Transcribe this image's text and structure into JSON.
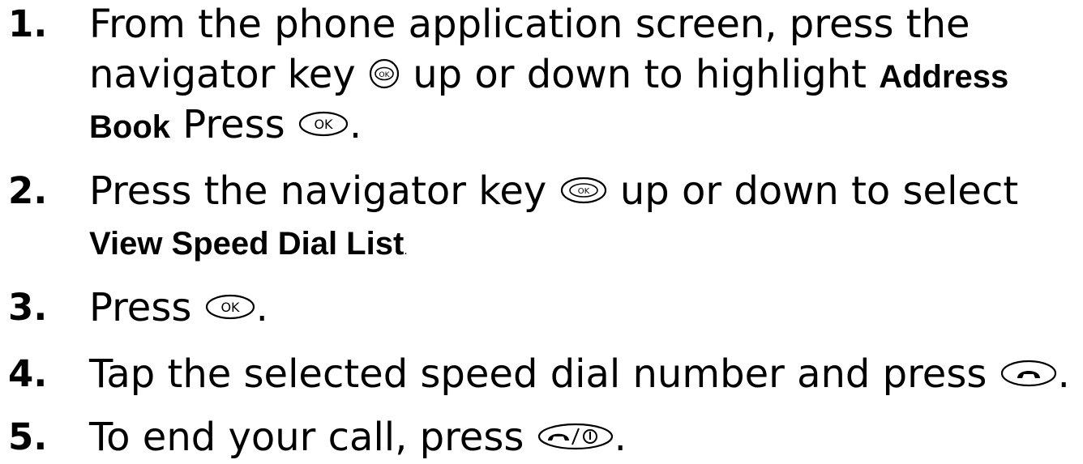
{
  "steps": [
    {
      "num": "1.",
      "l1": "From the phone application screen, press the",
      "l2a": "navigator key",
      "l2b": "up or down to highlight",
      "l2bold": "Address",
      "l3bold": "Book",
      "l3a": "Press",
      "l3b": "."
    },
    {
      "num": "2.",
      "l1a": "Press the navigator key",
      "l1b": "up or down to select",
      "l2bold": "View Speed Dial List",
      "l2dot": "."
    },
    {
      "num": "3.",
      "a": "Press",
      "b": "."
    },
    {
      "num": "4.",
      "a": "Tap the selected speed dial number and press",
      "b": "."
    },
    {
      "num": "5.",
      "a": "To end your call, press",
      "b": "."
    }
  ],
  "icons": {
    "ok": "OK",
    "navigator": "navigator-key-icon",
    "send": "send-key-icon",
    "end": "end-power-key-icon"
  }
}
